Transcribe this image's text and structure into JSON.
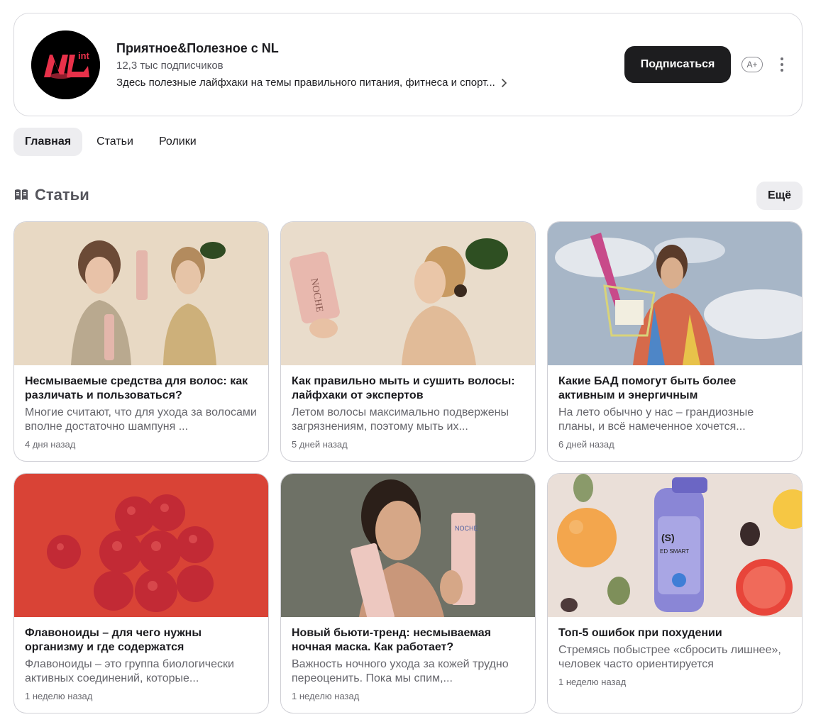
{
  "channel": {
    "logo_text": "NL",
    "logo_sub": "int",
    "name": "Приятное&Полезное с NL",
    "subscribers": "12,3 тыс подписчиков",
    "description": "Здесь полезные лайфхаки на темы правильного питания, фитнеса и спорт...",
    "subscribe_label": "Подписаться",
    "font_size_label": "A+"
  },
  "tabs": [
    {
      "label": "Главная",
      "active": true
    },
    {
      "label": "Статьи",
      "active": false
    },
    {
      "label": "Ролики",
      "active": false
    }
  ],
  "section": {
    "title": "Статьи",
    "more_label": "Ещё"
  },
  "articles": [
    {
      "title": "Несмываемые средства для волос: как различать и пользоваться?",
      "snippet": "Многие считают, что для ухода за волосами вполне достаточно шампуня ...",
      "time": "4 дня назад"
    },
    {
      "title": "Как правильно мыть и сушить волосы: лайфхаки от экспертов",
      "snippet": "Летом волосы максимально подвержены загрязнениям, поэтому мыть их...",
      "time": "5 дней назад"
    },
    {
      "title": "Какие БАД помогут быть более активным и энергичным",
      "snippet": "На лето обычно у нас – грандиозные планы, и всё намеченное хочется...",
      "time": "6 дней назад"
    },
    {
      "title": "Флавоноиды – для чего нужны организму и где содержатся",
      "snippet": "Флавоноиды – это группа биологически активных соединений, которые...",
      "time": "1 неделю назад"
    },
    {
      "title": "Новый бьюти-тренд: несмываемая ночная маска. Как работает?",
      "snippet": "Важность ночного ухода за кожей трудно переоценить. Пока мы спим,...",
      "time": "1 неделю назад"
    },
    {
      "title": "Топ-5 ошибок при похудении",
      "snippet": "Стремясь побыстрее «сбросить лишнее», человек часто ориентируется исключительно на значения весов,...",
      "time": "1 неделю назад"
    }
  ],
  "images": {
    "tube_label_1": "NOCHE",
    "tube_label_2": "NOCHE",
    "shaker_label": "(S)",
    "shaker_sub": "ED SMART"
  }
}
